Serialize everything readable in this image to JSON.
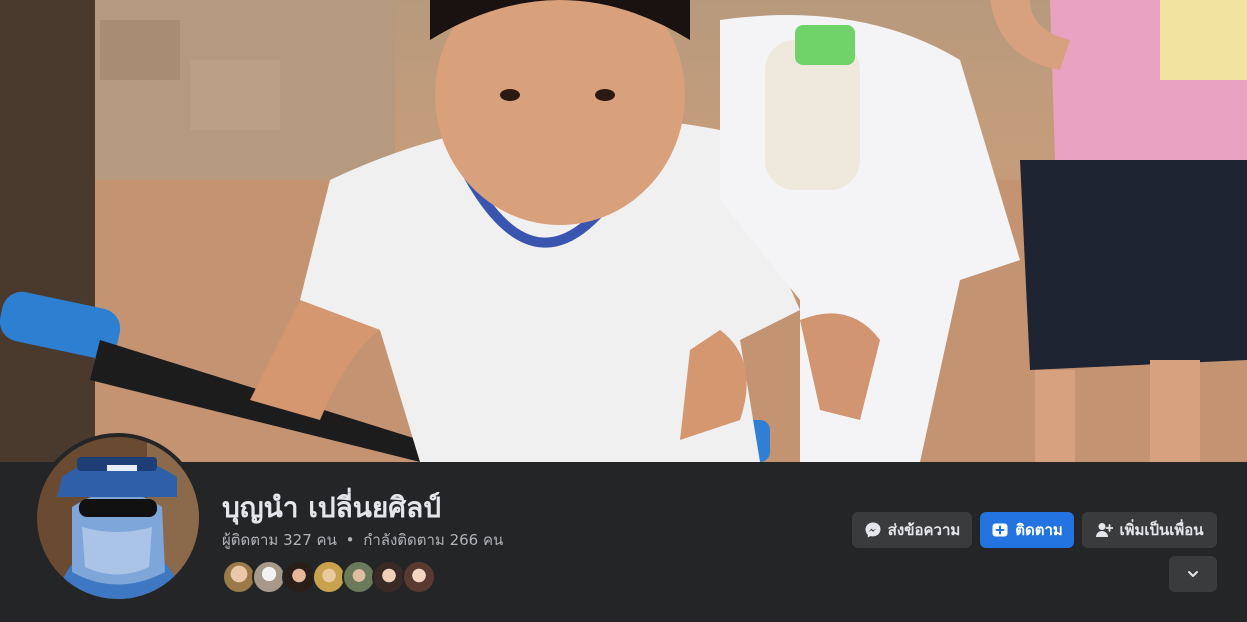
{
  "profile": {
    "name": "บุญนำ เปลี่นยศิลป์",
    "followers_label": "ผู้ติดตาม",
    "followers_count": "327",
    "followers_unit": "คน",
    "separator": "•",
    "following_label": "กำลังติดตาม",
    "following_count": "266",
    "following_unit": "คน",
    "mutual_friends_count": 7
  },
  "actions": {
    "message_label": "ส่งข้อความ",
    "follow_label": "ติดตาม",
    "add_friend_label": "เพิ่มเป็นเพื่อน"
  },
  "icons": {
    "message": "messenger-icon",
    "follow": "follow-icon",
    "add_friend": "add-friend-icon",
    "more": "chevron-down-icon"
  },
  "colors": {
    "background": "#242526",
    "primary": "#2374e1",
    "secondary_button": "#3a3b3c",
    "text": "#e4e6eb",
    "muted_text": "#b0b3b8"
  }
}
